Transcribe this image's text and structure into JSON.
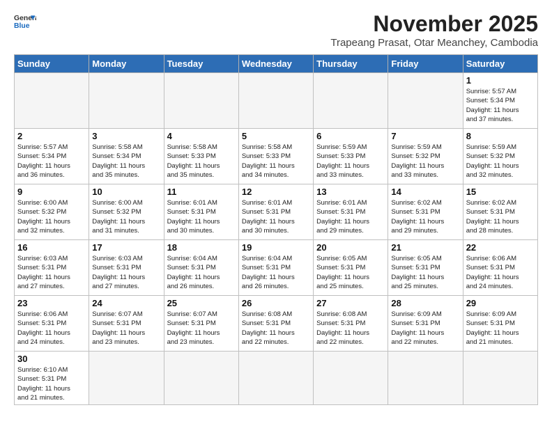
{
  "header": {
    "logo_general": "General",
    "logo_blue": "Blue",
    "month_title": "November 2025",
    "subtitle": "Trapeang Prasat, Otar Meanchey, Cambodia"
  },
  "weekdays": [
    "Sunday",
    "Monday",
    "Tuesday",
    "Wednesday",
    "Thursday",
    "Friday",
    "Saturday"
  ],
  "weeks": [
    [
      {
        "day": "",
        "info": ""
      },
      {
        "day": "",
        "info": ""
      },
      {
        "day": "",
        "info": ""
      },
      {
        "day": "",
        "info": ""
      },
      {
        "day": "",
        "info": ""
      },
      {
        "day": "",
        "info": ""
      },
      {
        "day": "1",
        "info": "Sunrise: 5:57 AM\nSunset: 5:34 PM\nDaylight: 11 hours\nand 37 minutes."
      }
    ],
    [
      {
        "day": "2",
        "info": "Sunrise: 5:57 AM\nSunset: 5:34 PM\nDaylight: 11 hours\nand 36 minutes."
      },
      {
        "day": "3",
        "info": "Sunrise: 5:58 AM\nSunset: 5:34 PM\nDaylight: 11 hours\nand 35 minutes."
      },
      {
        "day": "4",
        "info": "Sunrise: 5:58 AM\nSunset: 5:33 PM\nDaylight: 11 hours\nand 35 minutes."
      },
      {
        "day": "5",
        "info": "Sunrise: 5:58 AM\nSunset: 5:33 PM\nDaylight: 11 hours\nand 34 minutes."
      },
      {
        "day": "6",
        "info": "Sunrise: 5:59 AM\nSunset: 5:33 PM\nDaylight: 11 hours\nand 33 minutes."
      },
      {
        "day": "7",
        "info": "Sunrise: 5:59 AM\nSunset: 5:32 PM\nDaylight: 11 hours\nand 33 minutes."
      },
      {
        "day": "8",
        "info": "Sunrise: 5:59 AM\nSunset: 5:32 PM\nDaylight: 11 hours\nand 32 minutes."
      }
    ],
    [
      {
        "day": "9",
        "info": "Sunrise: 6:00 AM\nSunset: 5:32 PM\nDaylight: 11 hours\nand 32 minutes."
      },
      {
        "day": "10",
        "info": "Sunrise: 6:00 AM\nSunset: 5:32 PM\nDaylight: 11 hours\nand 31 minutes."
      },
      {
        "day": "11",
        "info": "Sunrise: 6:01 AM\nSunset: 5:31 PM\nDaylight: 11 hours\nand 30 minutes."
      },
      {
        "day": "12",
        "info": "Sunrise: 6:01 AM\nSunset: 5:31 PM\nDaylight: 11 hours\nand 30 minutes."
      },
      {
        "day": "13",
        "info": "Sunrise: 6:01 AM\nSunset: 5:31 PM\nDaylight: 11 hours\nand 29 minutes."
      },
      {
        "day": "14",
        "info": "Sunrise: 6:02 AM\nSunset: 5:31 PM\nDaylight: 11 hours\nand 29 minutes."
      },
      {
        "day": "15",
        "info": "Sunrise: 6:02 AM\nSunset: 5:31 PM\nDaylight: 11 hours\nand 28 minutes."
      }
    ],
    [
      {
        "day": "16",
        "info": "Sunrise: 6:03 AM\nSunset: 5:31 PM\nDaylight: 11 hours\nand 27 minutes."
      },
      {
        "day": "17",
        "info": "Sunrise: 6:03 AM\nSunset: 5:31 PM\nDaylight: 11 hours\nand 27 minutes."
      },
      {
        "day": "18",
        "info": "Sunrise: 6:04 AM\nSunset: 5:31 PM\nDaylight: 11 hours\nand 26 minutes."
      },
      {
        "day": "19",
        "info": "Sunrise: 6:04 AM\nSunset: 5:31 PM\nDaylight: 11 hours\nand 26 minutes."
      },
      {
        "day": "20",
        "info": "Sunrise: 6:05 AM\nSunset: 5:31 PM\nDaylight: 11 hours\nand 25 minutes."
      },
      {
        "day": "21",
        "info": "Sunrise: 6:05 AM\nSunset: 5:31 PM\nDaylight: 11 hours\nand 25 minutes."
      },
      {
        "day": "22",
        "info": "Sunrise: 6:06 AM\nSunset: 5:31 PM\nDaylight: 11 hours\nand 24 minutes."
      }
    ],
    [
      {
        "day": "23",
        "info": "Sunrise: 6:06 AM\nSunset: 5:31 PM\nDaylight: 11 hours\nand 24 minutes."
      },
      {
        "day": "24",
        "info": "Sunrise: 6:07 AM\nSunset: 5:31 PM\nDaylight: 11 hours\nand 23 minutes."
      },
      {
        "day": "25",
        "info": "Sunrise: 6:07 AM\nSunset: 5:31 PM\nDaylight: 11 hours\nand 23 minutes."
      },
      {
        "day": "26",
        "info": "Sunrise: 6:08 AM\nSunset: 5:31 PM\nDaylight: 11 hours\nand 22 minutes."
      },
      {
        "day": "27",
        "info": "Sunrise: 6:08 AM\nSunset: 5:31 PM\nDaylight: 11 hours\nand 22 minutes."
      },
      {
        "day": "28",
        "info": "Sunrise: 6:09 AM\nSunset: 5:31 PM\nDaylight: 11 hours\nand 22 minutes."
      },
      {
        "day": "29",
        "info": "Sunrise: 6:09 AM\nSunset: 5:31 PM\nDaylight: 11 hours\nand 21 minutes."
      }
    ],
    [
      {
        "day": "30",
        "info": "Sunrise: 6:10 AM\nSunset: 5:31 PM\nDaylight: 11 hours\nand 21 minutes."
      },
      {
        "day": "",
        "info": ""
      },
      {
        "day": "",
        "info": ""
      },
      {
        "day": "",
        "info": ""
      },
      {
        "day": "",
        "info": ""
      },
      {
        "day": "",
        "info": ""
      },
      {
        "day": "",
        "info": ""
      }
    ]
  ]
}
